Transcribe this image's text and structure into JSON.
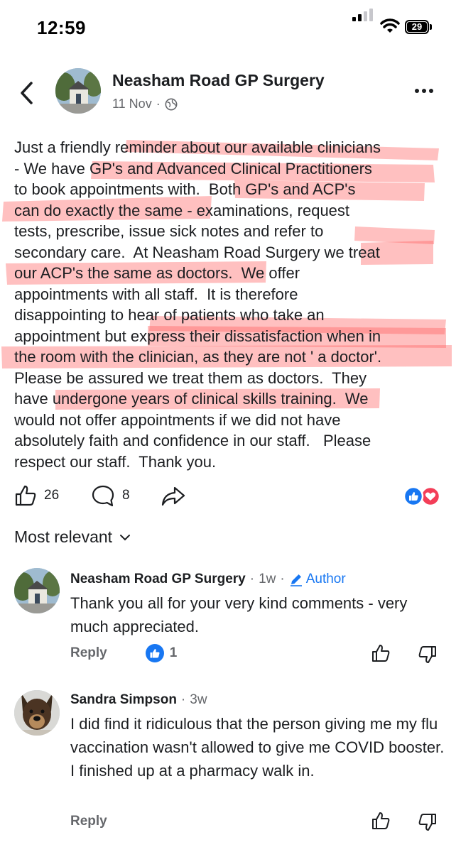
{
  "status_bar": {
    "time": "12:59",
    "battery": "29"
  },
  "post": {
    "page_name": "Neasham Road GP Surgery",
    "date": "11 Nov",
    "lines": [
      "Just a friendly reminder about our available clinicians",
      "- We have GP's and Advanced Clinical Practitioners",
      "to book appointments with.  Both GP's and ACP's",
      "can do exactly the same - examinations, request",
      "tests, prescribe, issue sick notes and refer to",
      "secondary care.  At Neasham Road Surgery we treat",
      "our ACP's the same as doctors.  We offer",
      "appointments with all staff.  It is therefore",
      "disappointing to hear of patients who take an",
      "appointment but express their dissatisfaction when in",
      "the room with the clinician, as they are not ' a doctor'.",
      "Please be assured we treat them as doctors.  They",
      "have undergone years of clinical skills training.  We",
      "would not offer appointments if we did not have",
      "absolutely faith and confidence in our staff.   Please",
      "respect our staff.  Thank you."
    ],
    "like_count": "26",
    "comment_count": "8"
  },
  "sort_label": "Most relevant",
  "comments": [
    {
      "name": "Neasham Road GP Surgery",
      "age": "1w",
      "badge": "Author",
      "text": "Thank you all for your very kind comments - very much appreciated.",
      "reply_label": "Reply",
      "reactions": "1"
    },
    {
      "name": "Sandra Simpson",
      "age": "3w",
      "text": "I did find it ridiculous that the person giving me my flu vaccination wasn't allowed to give me COVID booster. I finished up at a pharmacy walk in.",
      "reply_label": "Reply"
    }
  ],
  "colors": {
    "text": "#1c1e21",
    "secondary": "#65676b",
    "brand_blue": "#1877f2",
    "highlight": "#ff5a5a",
    "love_red": "#f33e58"
  },
  "icons": [
    "back-arrow-icon",
    "globe-icon",
    "more-options-icon",
    "like-icon",
    "comment-icon",
    "share-icon",
    "like-reaction-icon",
    "love-reaction-icon",
    "chevron-down-icon",
    "pencil-icon",
    "thumbs-up-icon",
    "thumbs-down-icon"
  ]
}
